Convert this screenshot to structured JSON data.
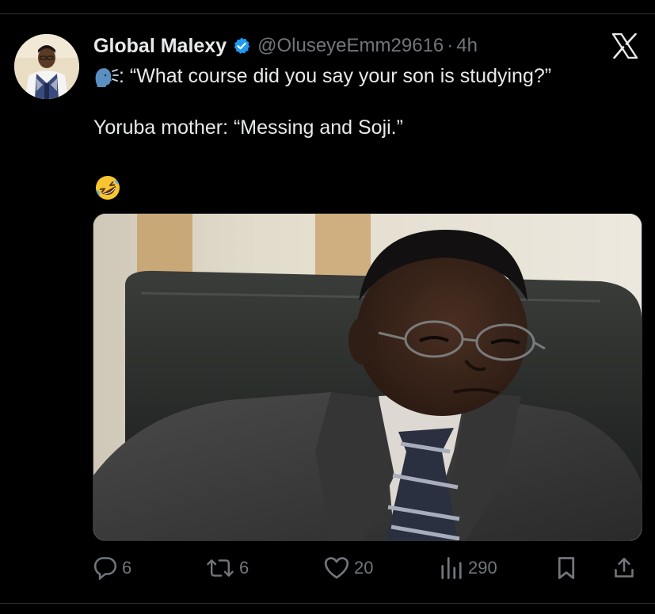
{
  "tweet": {
    "author_name": "Global Malexy",
    "handle": "@OluseyeEmm29616",
    "separator": "·",
    "time": "4h",
    "line1": ": “What course did you say your son is studying?”",
    "line2": "Yoruba mother: “Messing and Soji.”"
  },
  "actions": {
    "replies": "6",
    "reposts": "6",
    "likes": "20",
    "views": "290"
  },
  "icons": {
    "verified": "verified-badge-icon",
    "platform": "x-logo-icon",
    "speaking": "speaking-head-emoji",
    "laughing": "rolling-on-floor-laughing-emoji",
    "reply": "reply-icon",
    "repost": "repost-icon",
    "like": "heart-icon",
    "views": "views-icon",
    "bookmark": "bookmark-icon",
    "share": "share-icon"
  },
  "colors": {
    "background": "#000000",
    "text": "#e7e9ea",
    "muted": "#71767b",
    "verified": "#1d9bf0"
  }
}
